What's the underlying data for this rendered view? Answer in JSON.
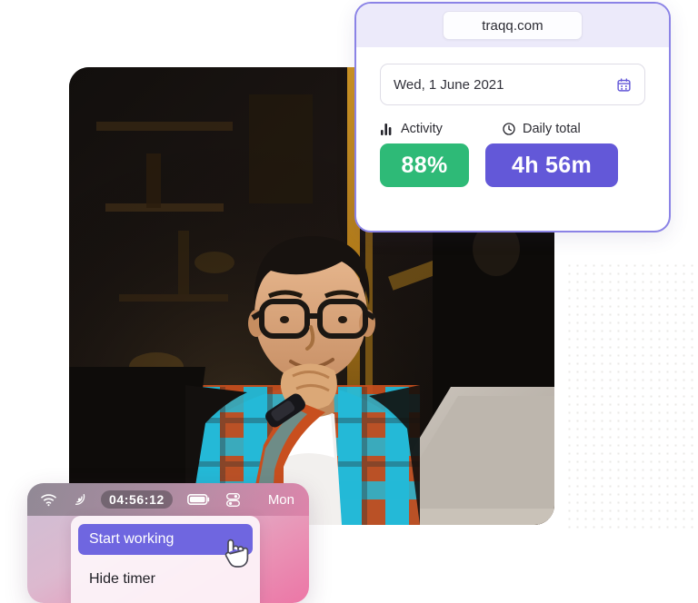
{
  "dashboard_card": {
    "url_pill": "traqq.com",
    "date_field": {
      "value": "Wed, 1 June 2021",
      "icon": "calendar-icon"
    },
    "metrics": [
      {
        "icon": "bar-chart-icon",
        "label": "Activity",
        "value": "88%",
        "color": "#2eba77"
      },
      {
        "icon": "clock-icon",
        "label": "Daily total",
        "value": "4h 56m",
        "color": "#6358d8"
      }
    ]
  },
  "menubar_widget": {
    "status_icons": [
      "wifi-icon",
      "activity-monitor-icon",
      "battery-icon",
      "control-center-icon"
    ],
    "timer": "04:56:12",
    "day": "Mon",
    "menu": {
      "items": [
        {
          "label": "Start working",
          "selected": true
        },
        {
          "label": "Hide timer",
          "selected": false
        }
      ]
    },
    "cursor": "pointing-hand-cursor"
  },
  "photo": {
    "alt": "man-with-glasses-at-laptop-photo"
  },
  "decoration": {
    "dot_grid": "dot-grid-pattern"
  },
  "colors": {
    "accent_purple": "#6358d8",
    "accent_green": "#2eba77",
    "card_border": "#8b83e6",
    "card_header": "#eceafa"
  }
}
